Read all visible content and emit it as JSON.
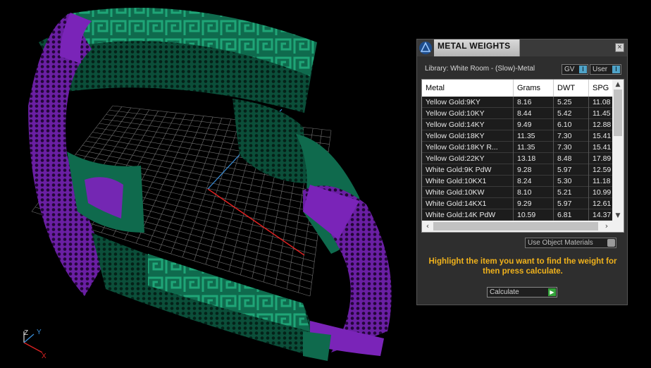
{
  "panel": {
    "title": "METAL WEIGHTS",
    "close_glyph": "×",
    "library_label": "Library: White Room - (Slow)-Metal",
    "gv_label": "GV",
    "user_label": "User",
    "chip_glyph": "I",
    "columns": [
      "Metal",
      "Grams",
      "DWT",
      "SPG"
    ],
    "rows": [
      [
        "Yellow Gold:9KY",
        "8.16",
        "5.25",
        "11.08"
      ],
      [
        "Yellow Gold:10KY",
        "8.44",
        "5.42",
        "11.45"
      ],
      [
        "Yellow Gold:14KY",
        "9.49",
        "6.10",
        "12.88"
      ],
      [
        "Yellow Gold:18KY",
        "11.35",
        "7.30",
        "15.41"
      ],
      [
        "Yellow Gold:18KY R...",
        "11.35",
        "7.30",
        "15.41"
      ],
      [
        "Yellow Gold:22KY",
        "13.18",
        "8.48",
        "17.89"
      ],
      [
        "White Gold:9K PdW",
        "9.28",
        "5.97",
        "12.59"
      ],
      [
        "White Gold:10KX1",
        "8.24",
        "5.30",
        "11.18"
      ],
      [
        "White Gold:10KW",
        "8.10",
        "5.21",
        "10.99"
      ],
      [
        "White Gold:14KX1",
        "9.29",
        "5.97",
        "12.61"
      ],
      [
        "White Gold:14K PdW",
        "10.59",
        "6.81",
        "14.37"
      ]
    ],
    "use_object_materials": "Use Object Materials",
    "instruction": "Highlight the item you want to find the weight for then press calculate.",
    "calculate_label": "Calculate",
    "scroll_up": "▲",
    "scroll_down": "▼",
    "scroll_left": "‹",
    "scroll_right": "›"
  },
  "viewport": {
    "axis_labels": {
      "z": "Z",
      "y": "Y",
      "x": "X"
    },
    "colors": {
      "green": "#0f6a4d",
      "purple": "#7a24b8",
      "grid": "#cfcfcf",
      "axis_x": "#d22",
      "axis_y": "#3a8ed8"
    }
  }
}
